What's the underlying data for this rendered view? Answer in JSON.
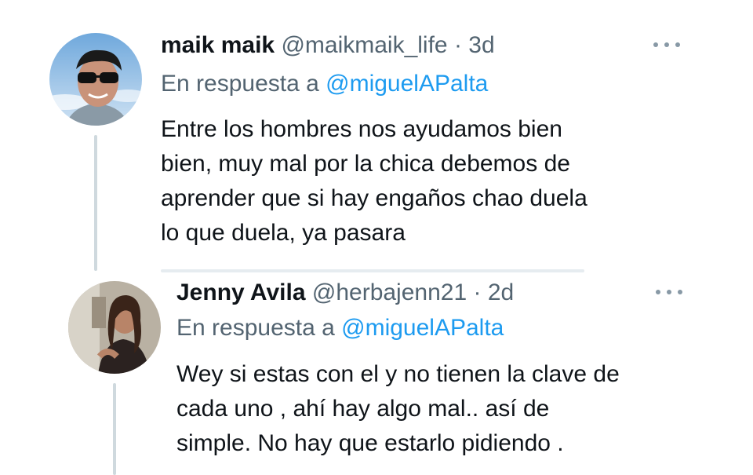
{
  "tweets": [
    {
      "name": "maik maik",
      "handle": "@maikmaik_life",
      "separator": "·",
      "time": "3d",
      "reply_prefix": "En respuesta a",
      "reply_mention": "@miguelAPalta",
      "text": "Entre los hombres nos ayudamos bien\nbien, muy mal por la chica debemos de\naprender que si hay engaños chao duela\nlo que duela, ya pasara",
      "avatar_icon": "person-with-sunglasses-avatar",
      "more_icon": "more-options-icon"
    },
    {
      "name": "Jenny Avila",
      "handle": "@herbajenn21",
      "separator": "·",
      "time": "2d",
      "reply_prefix": "En respuesta a",
      "reply_mention": "@miguelAPalta",
      "text": "Wey si estas con el y no tienen la clave de\ncada uno , ahí hay algo mal.. así de\nsimple. No hay que estarlo pidiendo .",
      "avatar_icon": "woman-selfie-avatar",
      "more_icon": "more-options-icon"
    }
  ],
  "colors": {
    "text": "#0f1419",
    "secondary": "#536471",
    "mention": "#1d9bf0",
    "thread_line": "#cfd9de"
  }
}
